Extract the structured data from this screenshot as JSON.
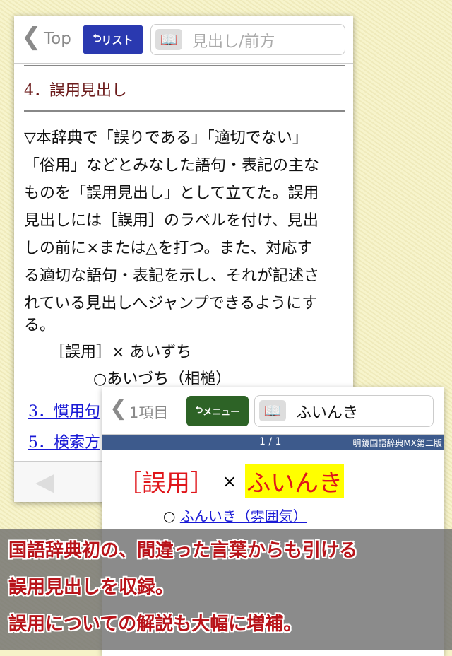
{
  "back": {
    "nav": {
      "back_label": "Top",
      "list_button": "リスト",
      "search_placeholder": "見出し/前方"
    },
    "heading": "4．誤用見出し",
    "body_lines": [
      "▽本辞典で「誤りである」「適切でない」",
      "「俗用」などとみなした語句・表記の主な",
      "ものを「誤用見出し」として立てた。誤用",
      "見出しには［誤用］のラベルを付け、見出",
      "しの前に×または△を打つ。また、対応す",
      "る適切な語句・表記を示し、それが記述さ",
      "れている見出しへジャンプできるようにす",
      "る。"
    ],
    "example1": "［誤用］× あいずち",
    "example2": "○あいづち（相槌）",
    "links": [
      "3．慣用句",
      "5．検索方"
    ]
  },
  "front": {
    "nav": {
      "back_label": "1項目",
      "menu_button": "メニュー",
      "search_value": "ふいんき"
    },
    "page_indicator": "1 / 1",
    "dictionary_name": "明鏡国語辞典MX第二版",
    "label": "［誤用］",
    "cross": "×",
    "headword": "ふいんき",
    "correct_mark": "○",
    "correct_link": "ふんいき（雰囲気）"
  },
  "caption": [
    "国語辞典初の、間違った言葉からも引ける",
    "誤用見出しを収録。",
    "誤用についての解説も大幅に増補。"
  ],
  "colors": {
    "list_button": "#2a39b0",
    "menu_button": "#2d6326",
    "heading": "#6b1a1a",
    "link": "#1a1ad6",
    "label": "#e0161b",
    "highlight": "#ffff00",
    "caption": "#b8141a"
  }
}
